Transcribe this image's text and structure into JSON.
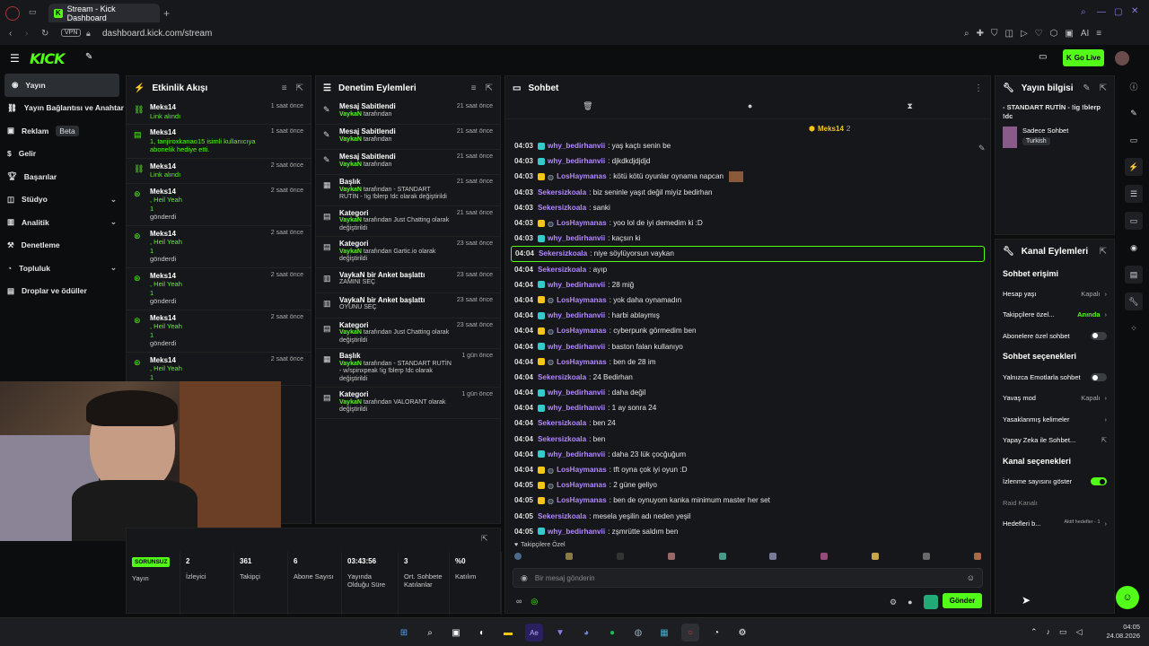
{
  "browser": {
    "tab_title": "Stream - Kick Dashboard",
    "url": "dashboard.kick.com/stream",
    "vpn_label": "VPN",
    "ai_label": "AI"
  },
  "header": {
    "logo": "KICK",
    "go_live": "Go Live"
  },
  "sidebar": {
    "items": [
      {
        "label": "Yayın",
        "icon": "broadcast-icon",
        "chevron": false
      },
      {
        "label": "Yayın Bağlantısı ve Anahtarı",
        "icon": "link-icon",
        "chevron": false
      },
      {
        "label": "Reklam",
        "icon": "ad-icon",
        "chevron": false,
        "badge": "Beta"
      },
      {
        "label": "Gelir",
        "icon": "money-icon",
        "chevron": false
      },
      {
        "label": "Başarılar",
        "icon": "trophy-icon",
        "chevron": false
      },
      {
        "label": "Stüdyo",
        "icon": "studio-icon",
        "chevron": true
      },
      {
        "label": "Analitik",
        "icon": "chart-icon",
        "chevron": true
      },
      {
        "label": "Denetleme",
        "icon": "hammer-icon",
        "chevron": false
      },
      {
        "label": "Topluluk",
        "icon": "community-icon",
        "chevron": true
      },
      {
        "label": "Droplar ve ödüller",
        "icon": "gift-icon",
        "chevron": false
      }
    ]
  },
  "activity": {
    "title": "Etkinlik Akışı",
    "events": [
      {
        "name": "Meks14",
        "line": "Link alındı",
        "time": "1 saat önce",
        "icon": "link-icon"
      },
      {
        "name": "Meks14",
        "line": "1, tanjiroxkanao15 isimli kullanıcıya abonelik hediye etti.",
        "time": "1 saat önce",
        "icon": "gift-icon"
      },
      {
        "name": "Meks14",
        "line": "Link alındı",
        "time": "2 saat önce",
        "icon": "link-icon"
      },
      {
        "name": "Meks14",
        "line": ", Heil Yeah",
        "extra": "1",
        "sub": "gönderdi",
        "time": "2 saat önce",
        "icon": "kick-icon"
      },
      {
        "name": "Meks14",
        "line": ", Heil Yeah",
        "extra": "1",
        "sub": "gönderdi",
        "time": "2 saat önce",
        "icon": "kick-icon"
      },
      {
        "name": "Meks14",
        "line": ", Heil Yeah",
        "extra": "1",
        "sub": "gönderdi",
        "time": "2 saat önce",
        "icon": "kick-icon"
      },
      {
        "name": "Meks14",
        "line": ", Heil Yeah",
        "extra": "1",
        "sub": "gönderdi",
        "time": "2 saat önce",
        "icon": "kick-icon"
      },
      {
        "name": "Meks14",
        "line": ", Heil Yeah",
        "extra": "1",
        "sub": "",
        "time": "2 saat önce",
        "icon": "kick-icon"
      }
    ]
  },
  "moderation": {
    "title": "Denetim Eylemleri",
    "items": [
      {
        "title": "Mesaj Sabitlendi",
        "actor": "VaykaN",
        "rest": " tarafından",
        "time": "21 saat önce",
        "icon": "pin-icon"
      },
      {
        "title": "Mesaj Sabitlendi",
        "actor": "VaykaN",
        "rest": " tarafından",
        "time": "21 saat önce",
        "icon": "pin-icon"
      },
      {
        "title": "Mesaj Sabitlendi",
        "actor": "VaykaN",
        "rest": " tarafından",
        "time": "21 saat önce",
        "icon": "pin-icon"
      },
      {
        "title": "Başlık",
        "actor": "VaykaN",
        "rest": " tarafından - STANDART RUTİN - !ig !blerp !dc olarak değiştirildi",
        "time": "21 saat önce",
        "icon": "title-icon"
      },
      {
        "title": "Kategori",
        "actor": "VaykaN",
        "rest": " tarafından Just Chatting olarak değiştirildi",
        "time": "21 saat önce",
        "icon": "category-icon"
      },
      {
        "title": "Kategori",
        "actor": "VaykaN",
        "rest": " tarafından Gartic.io olarak değiştirildi",
        "time": "23 saat önce",
        "icon": "category-icon"
      },
      {
        "title": "VaykaN bir Anket başlattı",
        "actor": "",
        "rest": "ZAMINI SEÇ",
        "time": "23 saat önce",
        "icon": "poll-icon"
      },
      {
        "title": "VaykaN bir Anket başlattı",
        "actor": "",
        "rest": "OYUNU SEÇ",
        "time": "23 saat önce",
        "icon": "poll-icon"
      },
      {
        "title": "Kategori",
        "actor": "VaykaN",
        "rest": " tarafından Just Chatting olarak değiştirildi",
        "time": "23 saat önce",
        "icon": "category-icon"
      },
      {
        "title": "Başlık",
        "actor": "VaykaN",
        "rest": " tarafından - STANDART RUTİN - w/spinxpeak !ig !blerp !dc olarak değiştirildi",
        "time": "1 gün önce",
        "icon": "title-icon"
      },
      {
        "title": "Kategori",
        "actor": "VaykaN",
        "rest": " tarafından VALORANT olarak değiştirildi",
        "time": "1 gün önce",
        "icon": "category-icon"
      }
    ]
  },
  "stats": [
    {
      "value": "SORUNSUZ",
      "label": "Yayın"
    },
    {
      "value": "2",
      "label": "İzleyici"
    },
    {
      "value": "361",
      "label": "Takipçi"
    },
    {
      "value": "6",
      "label": "Abone Sayısı"
    },
    {
      "value": "03:43:56",
      "label": "Yayında Olduğu Süre"
    },
    {
      "value": "3",
      "label": "Ort. Sohbete Katılanlar"
    },
    {
      "value": "%0",
      "label": "Katılım"
    }
  ],
  "chat": {
    "title": "Sohbet",
    "gifter": "Meks14",
    "gifter_count": "2",
    "messages": [
      {
        "time": "04:03",
        "user": "why_bedirhanvii",
        "color": "#b388ff",
        "badge": "#3cc",
        "text": ": yaş kaçtı senin be"
      },
      {
        "time": "04:03",
        "user": "why_bedirhanvii",
        "color": "#b388ff",
        "badge": "#3cc",
        "text": ": djkdkdjdjdjd"
      },
      {
        "time": "04:03",
        "user": "LosHaymanas",
        "color": "#b388ff",
        "badge": "#f5c518",
        "text": ": kötü kötü oyunlar oynama napcan"
      },
      {
        "time": "04:03",
        "user": "Sekersizkoala",
        "color": "#b388ff",
        "badge": "",
        "text": ": biz seninle yaşıt değil miyiz bedirhan"
      },
      {
        "time": "04:03",
        "user": "Sekersizkoala",
        "color": "#b388ff",
        "badge": "",
        "text": ": sanki"
      },
      {
        "time": "04:03",
        "user": "LosHaymanas",
        "color": "#b388ff",
        "badge": "#f5c518",
        "text": ": yoo lol de iyi demedim ki :D"
      },
      {
        "time": "04:03",
        "user": "why_bedirhanvii",
        "color": "#b388ff",
        "badge": "#3cc",
        "text": ": kaçsın ki"
      },
      {
        "time": "04:04",
        "user": "Sekersizkoala",
        "color": "#b388ff",
        "badge": "",
        "text": ": niye söylüyorsun vaykan",
        "highlight": true
      },
      {
        "time": "04:04",
        "user": "Sekersizkoala",
        "color": "#b388ff",
        "badge": "",
        "text": ": ayıp"
      },
      {
        "time": "04:04",
        "user": "why_bedirhanvii",
        "color": "#b388ff",
        "badge": "#3cc",
        "text": ": 28 miğ"
      },
      {
        "time": "04:04",
        "user": "LosHaymanas",
        "color": "#b388ff",
        "badge": "#f5c518",
        "text": ": yok daha oynamadın"
      },
      {
        "time": "04:04",
        "user": "why_bedirhanvii",
        "color": "#b388ff",
        "badge": "#3cc",
        "text": ": harbi ablaymış"
      },
      {
        "time": "04:04",
        "user": "LosHaymanas",
        "color": "#b388ff",
        "badge": "#f5c518",
        "text": ": cyberpunk görmedim ben"
      },
      {
        "time": "04:04",
        "user": "why_bedirhanvii",
        "color": "#b388ff",
        "badge": "#3cc",
        "text": ": baston falan kullanıyo"
      },
      {
        "time": "04:04",
        "user": "LosHaymanas",
        "color": "#b388ff",
        "badge": "#f5c518",
        "text": ": ben de 28 im"
      },
      {
        "time": "04:04",
        "user": "Sekersizkoala",
        "color": "#b388ff",
        "badge": "",
        "text": ": 24 Bedirhan"
      },
      {
        "time": "04:04",
        "user": "why_bedirhanvii",
        "color": "#b388ff",
        "badge": "#3cc",
        "text": ": daha değil"
      },
      {
        "time": "04:04",
        "user": "why_bedirhanvii",
        "color": "#b388ff",
        "badge": "#3cc",
        "text": ": 1 ay sonra 24"
      },
      {
        "time": "04:04",
        "user": "Sekersizkoala",
        "color": "#b388ff",
        "badge": "",
        "text": ": ben 24"
      },
      {
        "time": "04:04",
        "user": "Sekersizkoala",
        "color": "#b388ff",
        "badge": "",
        "text": ": ben"
      },
      {
        "time": "04:04",
        "user": "why_bedirhanvii",
        "color": "#b388ff",
        "badge": "#3cc",
        "text": ": daha 23 lük çocğuğum"
      },
      {
        "time": "04:04",
        "user": "LosHaymanas",
        "color": "#b388ff",
        "badge": "#f5c518",
        "text": ": tft oyna çok iyi oyun :D"
      },
      {
        "time": "04:05",
        "user": "LosHaymanas",
        "color": "#b388ff",
        "badge": "#f5c518",
        "text": ": 2 güne geliyo"
      },
      {
        "time": "04:05",
        "user": "LosHaymanas",
        "color": "#b388ff",
        "badge": "#f5c518",
        "text": ": ben de oynuyom kanka minimum master her set"
      },
      {
        "time": "04:05",
        "user": "Sekersizkoala",
        "color": "#b388ff",
        "badge": "",
        "text": ": mesela yeşilin adı neden yeşil"
      },
      {
        "time": "04:05",
        "user": "why_bedirhanvii",
        "color": "#b388ff",
        "badge": "#3cc",
        "text": ": zşmrütte saldım ben"
      }
    ],
    "followers_only": "Takipçilere Özel",
    "input_placeholder": "Bir mesaj gönderin",
    "send": "Gönder"
  },
  "stream_info": {
    "title": "Yayın bilgisi",
    "stream_title": "- STANDART RUTİN - !ig !blerp !dc",
    "category": "Sadece Sohbet",
    "language": "Turkish"
  },
  "channel_actions": {
    "title": "Kanal Eylemleri",
    "chat_access_title": "Sohbet erişimi",
    "rows1": [
      {
        "label": "Hesap yaşı",
        "value": "Kapalı",
        "kind": "chev"
      },
      {
        "label": "Takipçilere özel...",
        "value": "Anında",
        "kind": "chev-green"
      },
      {
        "label": "Abonelere özel sohbet",
        "value": "",
        "kind": "toggle-off"
      }
    ],
    "chat_options_title": "Sohbet seçenekleri",
    "rows2": [
      {
        "label": "Yalnızca Emotlarla sohbet",
        "value": "",
        "kind": "toggle-off"
      },
      {
        "label": "Yavaş mod",
        "value": "Kapalı",
        "kind": "chev"
      },
      {
        "label": "Yasaklanmış kelimeler",
        "value": "",
        "kind": "chev"
      },
      {
        "label": "Yapay Zeka ile Sohbet...",
        "value": "",
        "kind": "ext"
      }
    ],
    "channel_options_title": "Kanal seçenekleri",
    "rows3": [
      {
        "label": "İzlenme sayısını göster",
        "value": "",
        "kind": "toggle-on"
      },
      {
        "label": "Raid Kanalı",
        "value": "",
        "kind": "muted"
      },
      {
        "label": "Hedefleri b...",
        "value": "Aktif hedefler - 1",
        "kind": "chev"
      }
    ]
  },
  "taskbar": {
    "time": "04:05",
    "date": "24.08.2026"
  },
  "colors": {
    "accent": "#53fc18",
    "bg": "#0b0d0e",
    "panel": "#15171a"
  }
}
